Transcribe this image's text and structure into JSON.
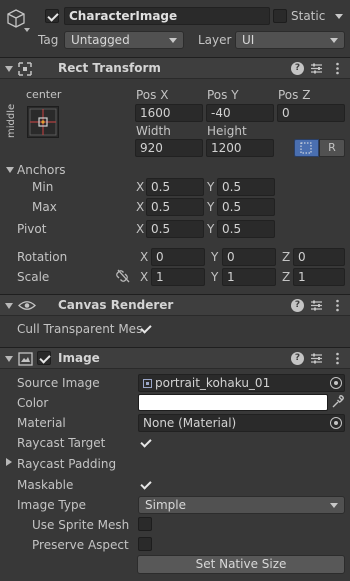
{
  "gameobject": {
    "name": "CharacterImage",
    "active": true,
    "static_label": "Static",
    "tag_label": "Tag",
    "tag_value": "Untagged",
    "layer_label": "Layer",
    "layer_value": "UI"
  },
  "rect_transform": {
    "title": "Rect Transform",
    "anchor_preset_top": "center",
    "anchor_preset_side": "middle",
    "pos_x_label": "Pos X",
    "pos_y_label": "Pos Y",
    "pos_z_label": "Pos Z",
    "pos_x": "1600",
    "pos_y": "-40",
    "pos_z": "0",
    "width_label": "Width",
    "height_label": "Height",
    "width": "920",
    "height": "1200",
    "raw_button": "R",
    "anchors_label": "Anchors",
    "min_label": "Min",
    "max_label": "Max",
    "anchor_min_x": "0.5",
    "anchor_min_y": "0.5",
    "anchor_max_x": "0.5",
    "anchor_max_y": "0.5",
    "pivot_label": "Pivot",
    "pivot_x": "0.5",
    "pivot_y": "0.5",
    "rotation_label": "Rotation",
    "rot_x": "0",
    "rot_y": "0",
    "rot_z": "0",
    "scale_label": "Scale",
    "scale_x": "1",
    "scale_y": "1",
    "scale_z": "1",
    "x": "X",
    "y": "Y",
    "z": "Z"
  },
  "canvas_renderer": {
    "title": "Canvas Renderer",
    "cull_label": "Cull Transparent Mes",
    "cull_checked": true
  },
  "image": {
    "title": "Image",
    "enabled": true,
    "source_image_label": "Source Image",
    "source_image_value": "portrait_kohaku_01",
    "color_label": "Color",
    "color_value": "#ffffff",
    "material_label": "Material",
    "material_value": "None (Material)",
    "raycast_target_label": "Raycast Target",
    "raycast_target_checked": true,
    "raycast_padding_label": "Raycast Padding",
    "maskable_label": "Maskable",
    "maskable_checked": true,
    "image_type_label": "Image Type",
    "image_type_value": "Simple",
    "use_sprite_mesh_label": "Use Sprite Mesh",
    "use_sprite_mesh_checked": false,
    "preserve_aspect_label": "Preserve Aspect",
    "preserve_aspect_checked": false,
    "set_native_size_label": "Set Native Size"
  },
  "colors": {
    "accent": "#4a6fb0",
    "background": "#383838",
    "field": "#2a2a2a"
  }
}
